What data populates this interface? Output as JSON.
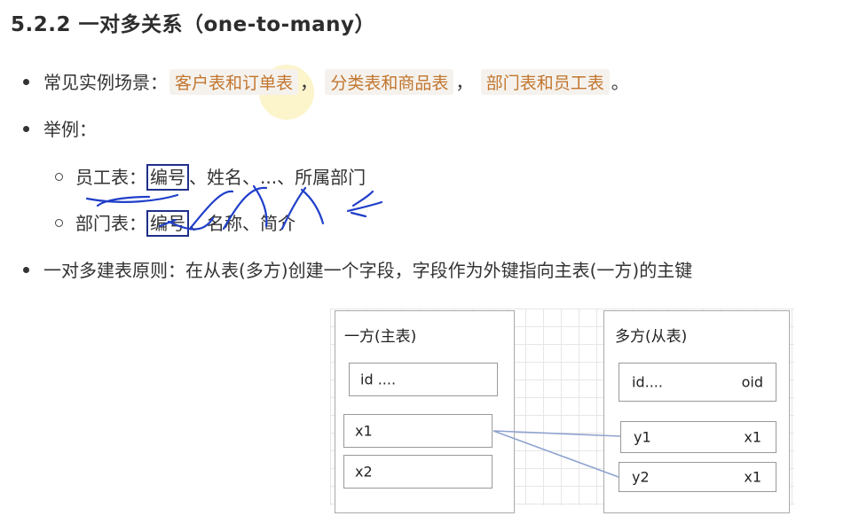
{
  "title": "5.2.2 一对多关系（one-to-many）",
  "bullet1": {
    "label": "常见实例场景：",
    "examples": [
      "客户表和订单表",
      "分类表和商品表",
      "部门表和员工表"
    ],
    "sep": "，",
    "end": "。"
  },
  "bullet2": {
    "label": "举例：",
    "sub1": {
      "table": "员工表：",
      "key": "编号",
      "rest": "、姓名、...、所属部门"
    },
    "sub2": {
      "table": "部门表：",
      "key": "编号",
      "rest": "、名称、简介"
    }
  },
  "bullet3": {
    "text": "一对多建表原则：在从表(多方)创建一个字段，字段作为外键指向主表(一方)的主键"
  },
  "diagram": {
    "left": {
      "title": "一方(主表)",
      "id_row": "id ....",
      "rows": [
        "x1",
        "x2"
      ]
    },
    "right": {
      "title": "多方(从表)",
      "id_row": "id....",
      "fk": "oid",
      "rows": [
        {
          "name": "y1",
          "fk": "x1"
        },
        {
          "name": "y2",
          "fk": "x1"
        }
      ]
    }
  }
}
